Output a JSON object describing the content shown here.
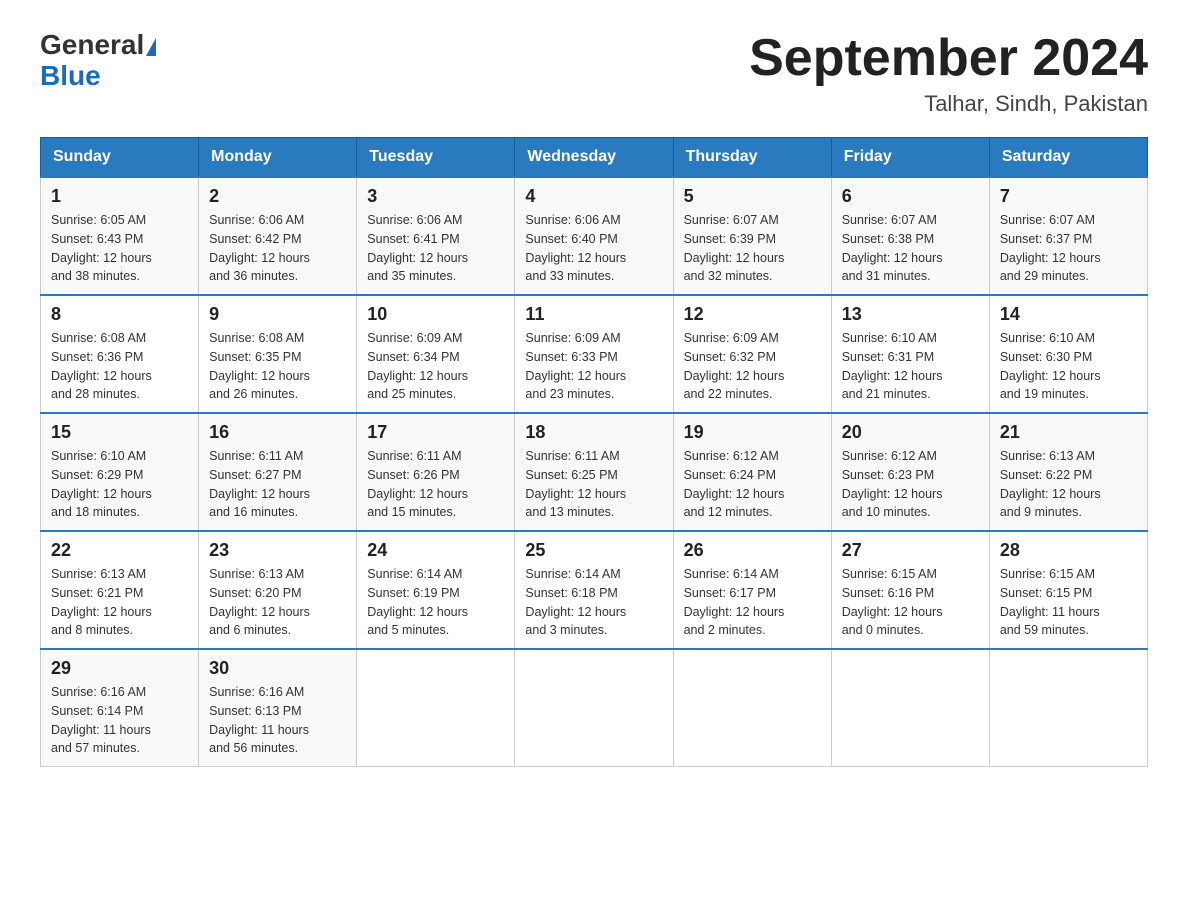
{
  "header": {
    "logo_general": "General",
    "logo_blue": "Blue",
    "month_title": "September 2024",
    "location": "Talhar, Sindh, Pakistan"
  },
  "days_of_week": [
    "Sunday",
    "Monday",
    "Tuesday",
    "Wednesday",
    "Thursday",
    "Friday",
    "Saturday"
  ],
  "weeks": [
    [
      {
        "day": "1",
        "sunrise": "6:05 AM",
        "sunset": "6:43 PM",
        "daylight": "12 hours and 38 minutes."
      },
      {
        "day": "2",
        "sunrise": "6:06 AM",
        "sunset": "6:42 PM",
        "daylight": "12 hours and 36 minutes."
      },
      {
        "day": "3",
        "sunrise": "6:06 AM",
        "sunset": "6:41 PM",
        "daylight": "12 hours and 35 minutes."
      },
      {
        "day": "4",
        "sunrise": "6:06 AM",
        "sunset": "6:40 PM",
        "daylight": "12 hours and 33 minutes."
      },
      {
        "day": "5",
        "sunrise": "6:07 AM",
        "sunset": "6:39 PM",
        "daylight": "12 hours and 32 minutes."
      },
      {
        "day": "6",
        "sunrise": "6:07 AM",
        "sunset": "6:38 PM",
        "daylight": "12 hours and 31 minutes."
      },
      {
        "day": "7",
        "sunrise": "6:07 AM",
        "sunset": "6:37 PM",
        "daylight": "12 hours and 29 minutes."
      }
    ],
    [
      {
        "day": "8",
        "sunrise": "6:08 AM",
        "sunset": "6:36 PM",
        "daylight": "12 hours and 28 minutes."
      },
      {
        "day": "9",
        "sunrise": "6:08 AM",
        "sunset": "6:35 PM",
        "daylight": "12 hours and 26 minutes."
      },
      {
        "day": "10",
        "sunrise": "6:09 AM",
        "sunset": "6:34 PM",
        "daylight": "12 hours and 25 minutes."
      },
      {
        "day": "11",
        "sunrise": "6:09 AM",
        "sunset": "6:33 PM",
        "daylight": "12 hours and 23 minutes."
      },
      {
        "day": "12",
        "sunrise": "6:09 AM",
        "sunset": "6:32 PM",
        "daylight": "12 hours and 22 minutes."
      },
      {
        "day": "13",
        "sunrise": "6:10 AM",
        "sunset": "6:31 PM",
        "daylight": "12 hours and 21 minutes."
      },
      {
        "day": "14",
        "sunrise": "6:10 AM",
        "sunset": "6:30 PM",
        "daylight": "12 hours and 19 minutes."
      }
    ],
    [
      {
        "day": "15",
        "sunrise": "6:10 AM",
        "sunset": "6:29 PM",
        "daylight": "12 hours and 18 minutes."
      },
      {
        "day": "16",
        "sunrise": "6:11 AM",
        "sunset": "6:27 PM",
        "daylight": "12 hours and 16 minutes."
      },
      {
        "day": "17",
        "sunrise": "6:11 AM",
        "sunset": "6:26 PM",
        "daylight": "12 hours and 15 minutes."
      },
      {
        "day": "18",
        "sunrise": "6:11 AM",
        "sunset": "6:25 PM",
        "daylight": "12 hours and 13 minutes."
      },
      {
        "day": "19",
        "sunrise": "6:12 AM",
        "sunset": "6:24 PM",
        "daylight": "12 hours and 12 minutes."
      },
      {
        "day": "20",
        "sunrise": "6:12 AM",
        "sunset": "6:23 PM",
        "daylight": "12 hours and 10 minutes."
      },
      {
        "day": "21",
        "sunrise": "6:13 AM",
        "sunset": "6:22 PM",
        "daylight": "12 hours and 9 minutes."
      }
    ],
    [
      {
        "day": "22",
        "sunrise": "6:13 AM",
        "sunset": "6:21 PM",
        "daylight": "12 hours and 8 minutes."
      },
      {
        "day": "23",
        "sunrise": "6:13 AM",
        "sunset": "6:20 PM",
        "daylight": "12 hours and 6 minutes."
      },
      {
        "day": "24",
        "sunrise": "6:14 AM",
        "sunset": "6:19 PM",
        "daylight": "12 hours and 5 minutes."
      },
      {
        "day": "25",
        "sunrise": "6:14 AM",
        "sunset": "6:18 PM",
        "daylight": "12 hours and 3 minutes."
      },
      {
        "day": "26",
        "sunrise": "6:14 AM",
        "sunset": "6:17 PM",
        "daylight": "12 hours and 2 minutes."
      },
      {
        "day": "27",
        "sunrise": "6:15 AM",
        "sunset": "6:16 PM",
        "daylight": "12 hours and 0 minutes."
      },
      {
        "day": "28",
        "sunrise": "6:15 AM",
        "sunset": "6:15 PM",
        "daylight": "11 hours and 59 minutes."
      }
    ],
    [
      {
        "day": "29",
        "sunrise": "6:16 AM",
        "sunset": "6:14 PM",
        "daylight": "11 hours and 57 minutes."
      },
      {
        "day": "30",
        "sunrise": "6:16 AM",
        "sunset": "6:13 PM",
        "daylight": "11 hours and 56 minutes."
      },
      null,
      null,
      null,
      null,
      null
    ]
  ]
}
